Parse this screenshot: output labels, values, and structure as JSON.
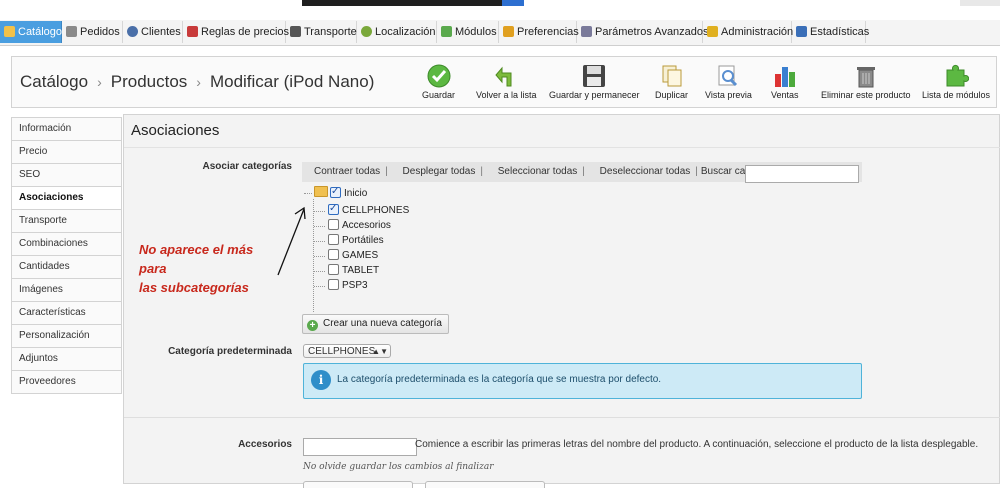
{
  "nav": {
    "items": [
      {
        "label": "Catálogo",
        "active": true,
        "color": "#f2b632"
      },
      {
        "label": "Pedidos",
        "color": "#7a7a7a"
      },
      {
        "label": "Clientes",
        "color": "#4a6fa8"
      },
      {
        "label": "Reglas de precios",
        "color": "#c83a3a"
      },
      {
        "label": "Transporte",
        "color": "#555555"
      },
      {
        "label": "Localización",
        "color": "#7aa83a"
      },
      {
        "label": "Módulos",
        "color": "#5aa94d"
      },
      {
        "label": "Preferencias",
        "color": "#e0a020"
      },
      {
        "label": "Parámetros Avanzados",
        "color": "#7a7a9a"
      },
      {
        "label": "Administración",
        "color": "#e0b020"
      },
      {
        "label": "Estadísticas",
        "color": "#3a6fb8"
      }
    ]
  },
  "breadcrumb": {
    "items": [
      "Catálogo",
      "Productos",
      "Modificar (iPod Nano)"
    ],
    "separator": "›"
  },
  "toolbar": {
    "buttons": [
      {
        "label": "Guardar",
        "icon": "save-check-icon"
      },
      {
        "label": "Volver a la lista",
        "icon": "back-arrow-icon"
      },
      {
        "label": "Guardar y permanecer",
        "icon": "floppy-disk-icon"
      },
      {
        "label": "Duplicar",
        "icon": "duplicate-icon"
      },
      {
        "label": "Vista previa",
        "icon": "preview-icon"
      },
      {
        "label": "Ventas",
        "icon": "bar-chart-icon"
      },
      {
        "label": "Eliminar este producto",
        "icon": "trash-icon"
      },
      {
        "label": "Lista de módulos",
        "icon": "puzzle-icon"
      }
    ]
  },
  "leftmenu": {
    "items": [
      {
        "label": "Información"
      },
      {
        "label": "Precio"
      },
      {
        "label": "SEO"
      },
      {
        "label": "Asociaciones",
        "active": true
      },
      {
        "label": "Transporte"
      },
      {
        "label": "Combinaciones"
      },
      {
        "label": "Cantidades"
      },
      {
        "label": "Imágenes"
      },
      {
        "label": "Características"
      },
      {
        "label": "Personalización"
      },
      {
        "label": "Adjuntos"
      },
      {
        "label": "Proveedores"
      }
    ]
  },
  "main": {
    "title": "Asociaciones",
    "categories_label": "Asociar categorías",
    "tree_actions": {
      "collapse": "Contraer todas",
      "expand": "Desplegar todas",
      "select_all": "Seleccionar todas",
      "deselect_all": "Deseleccionar todas",
      "search_label": "Buscar categoría:",
      "search_value": ""
    },
    "tree": {
      "root": {
        "label": "Inicio",
        "checked": true
      },
      "children": [
        {
          "label": "CELLPHONES",
          "checked": true
        },
        {
          "label": "Accesorios",
          "checked": false
        },
        {
          "label": "Portátiles",
          "checked": false
        },
        {
          "label": "GAMES",
          "checked": false
        },
        {
          "label": "TABLET",
          "checked": false
        },
        {
          "label": "PSP3",
          "checked": false
        }
      ]
    },
    "new_category_button": "Crear una nueva categoría",
    "default_category_label": "Categoría predeterminada",
    "default_category_value": "CELLPHONES",
    "info_text": "La categoría predeterminada es la categoría que se muestra por defecto.",
    "accessories_label": "Accesorios",
    "accessories_value": "",
    "accessories_help": "Comience a escribir las primeras letras del nombre del producto. A continuación, seleccione el producto de la lista desplegable.",
    "save_note": "No olvide guardar los cambios al finalizar"
  },
  "annotation": {
    "lines": [
      "No aparece el más",
      "para",
      "las subcategorías"
    ],
    "color": "#c8281c"
  }
}
